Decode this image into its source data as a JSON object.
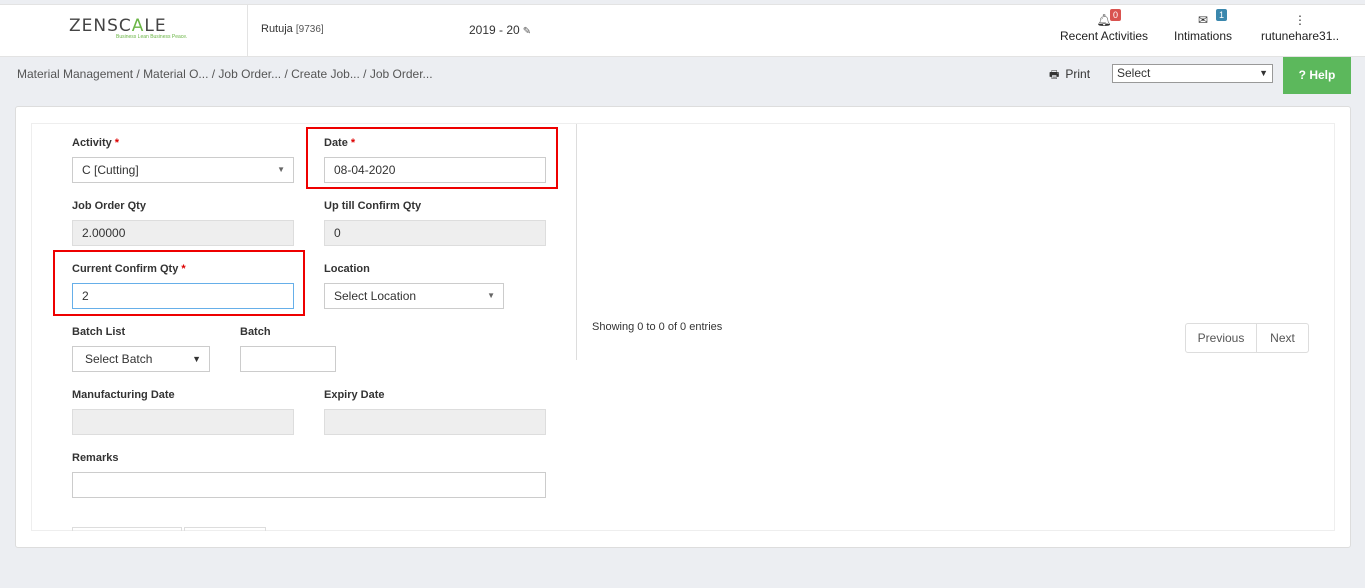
{
  "header": {
    "logo_prefix": "ZENSC",
    "logo_mid": "A",
    "logo_suffix": "LE",
    "tagline": "Business Lean Business Peace.",
    "user_name": "Rutuja",
    "user_code": "[9736]",
    "fiscal_year": "2019 - 20",
    "recent_activities": {
      "label": "Recent Activities",
      "count": "0"
    },
    "intimations": {
      "label": "Intimations",
      "count": "1"
    },
    "account": {
      "label": "rutunehare31.."
    }
  },
  "toolbar": {
    "breadcrumb": [
      "Material Management",
      " / Material O...",
      " / Job Order...",
      " / Create Job...",
      " / Job Order..."
    ],
    "print_label": "Print",
    "select_value": "Select",
    "help_label": "Help"
  },
  "form": {
    "activity_label": "Activity",
    "activity_value": "C [Cutting]",
    "date_label": "Date",
    "date_value": "08-04-2020",
    "job_order_qty_label": "Job Order Qty",
    "job_order_qty_value": "2.00000",
    "up_till_label": "Up till Confirm Qty",
    "up_till_value": "0",
    "current_confirm_label": "Current Confirm Qty",
    "current_confirm_value": "2",
    "location_label": "Location",
    "location_value": "Select Location",
    "batch_list_label": "Batch List",
    "batch_list_value": "Select Batch",
    "batch_label": "Batch",
    "mfg_date_label": "Manufacturing Date",
    "expiry_label": "Expiry Date",
    "remarks_label": "Remarks",
    "required_mark": "*"
  },
  "table": {
    "info": "Showing 0 to 0 of 0 entries",
    "previous": "Previous",
    "next": "Next"
  },
  "colors": {
    "highlight": "#e00000",
    "help": "#5cb85c",
    "accent_green": "#6ab545"
  }
}
